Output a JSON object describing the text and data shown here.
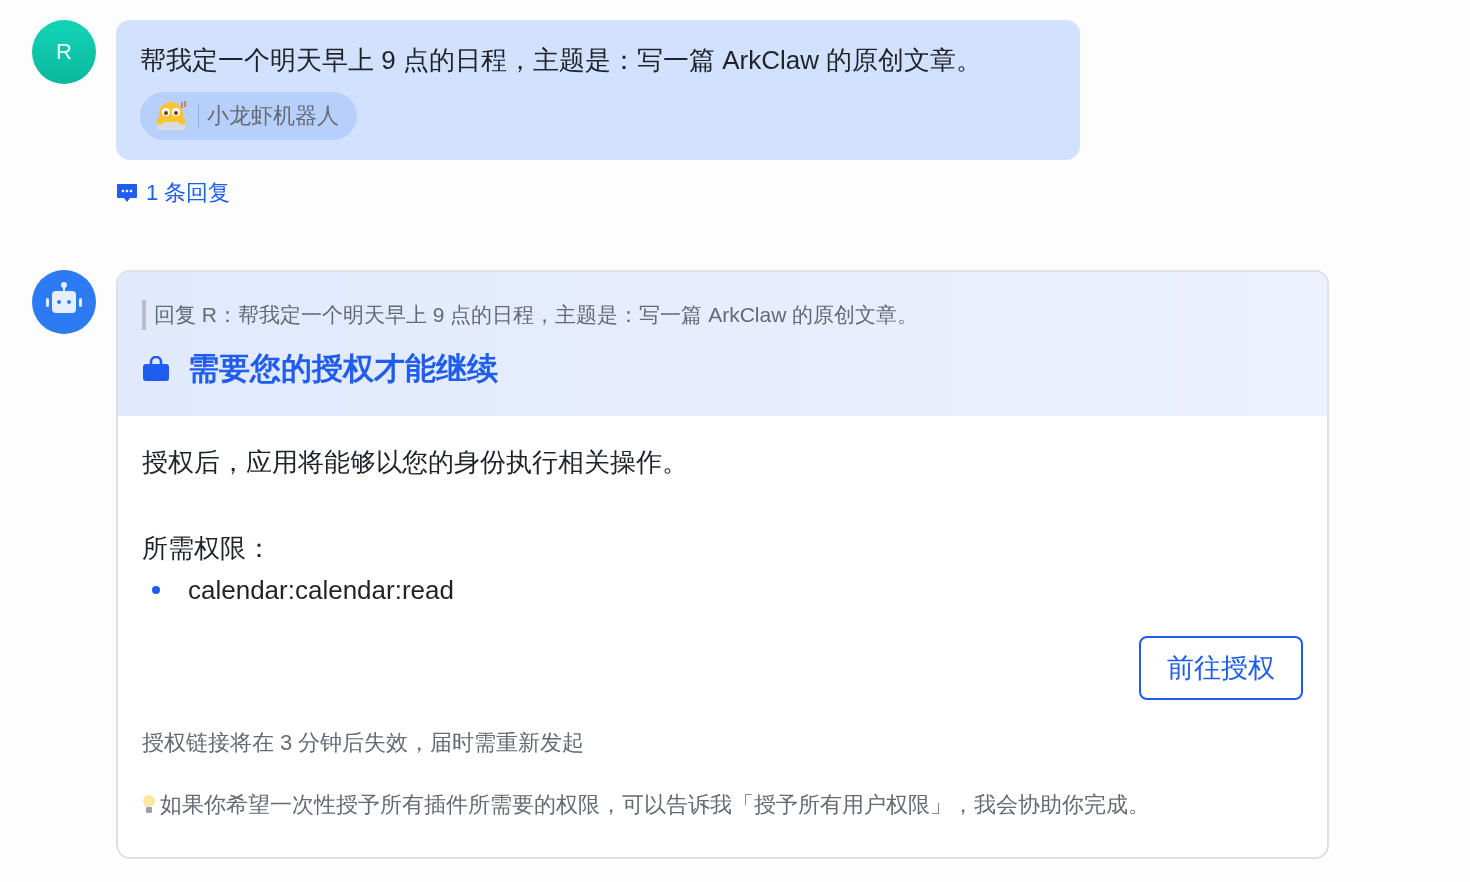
{
  "user_message": {
    "avatar": "R",
    "text": "帮我定一个明天早上 9 点的日程，主题是：写一篇 ArkClaw 的原创文章。",
    "mention": "小龙虾机器人",
    "replies": "1 条回复"
  },
  "bot_reply": {
    "quote": "回复 R：帮我定一个明天早上 9 点的日程，主题是：写一篇 ArkClaw 的原创文章。",
    "title": "需要您的授权才能继续",
    "intro": "授权后，应用将能够以您的身份执行相关操作。",
    "permissions_label": "所需权限：",
    "permissions": [
      "calendar:calendar:read"
    ],
    "button": "前往授权",
    "expiry_note": "授权链接将在 3 分钟后失效，届时需重新发起",
    "tip": "如果你希望一次性授予所有插件所需要的权限，可以告诉我「授予所有用户权限」，我会协助你完成。"
  }
}
